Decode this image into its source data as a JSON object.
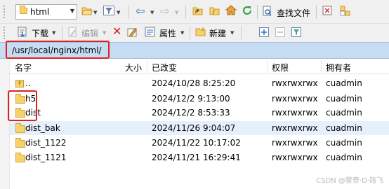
{
  "toolbar_top": {
    "drive_combo_value": "html",
    "find_files_label": "查找文件",
    "icons": [
      "folder-icon",
      "open-folder-icon",
      "filter-icon",
      "back-arrow-icon",
      "forward-arrow-icon",
      "parent-folder-icon",
      "root-folder-icon",
      "home-icon",
      "refresh-icon",
      "find-files-icon",
      "new-window-icon",
      "layout-icon"
    ]
  },
  "toolbar_bottom": {
    "download_label": "下载",
    "edit_label": "编辑",
    "properties_label": "属性",
    "new_label": "新建",
    "icons": [
      "download-icon",
      "edit-icon",
      "delete-icon",
      "rename-icon",
      "properties-icon",
      "new-folder-icon",
      "add-icon",
      "remove-icon",
      "filter-icon"
    ]
  },
  "address": {
    "path": "/usr/local/nginx/html/"
  },
  "columns": {
    "name": "名字",
    "size": "大小",
    "modified": "已改变",
    "permissions": "权限",
    "owner": "拥有者"
  },
  "files": [
    {
      "name": "..",
      "size": "",
      "modified": "2024/10/28 8:25:20",
      "permissions": "rwxrwxrwx",
      "owner": "cuadmin",
      "type": "parent"
    },
    {
      "name": "h5",
      "size": "",
      "modified": "2024/12/2 9:13:00",
      "permissions": "rwxrwxrwx",
      "owner": "cuadmin",
      "type": "folder"
    },
    {
      "name": "dist",
      "size": "",
      "modified": "2024/12/2 8:53:33",
      "permissions": "rwxrwxrwx",
      "owner": "cuadmin",
      "type": "folder"
    },
    {
      "name": "dist_bak",
      "size": "",
      "modified": "2024/11/26 9:04:07",
      "permissions": "rwxrwxrwx",
      "owner": "cuadmin",
      "type": "folder"
    },
    {
      "name": "dist_1122",
      "size": "",
      "modified": "2024/11/22 10:17:02",
      "permissions": "rwxrwxrwx",
      "owner": "cuadmin",
      "type": "folder"
    },
    {
      "name": "dist_1121",
      "size": "",
      "modified": "2024/11/21 16:29:41",
      "permissions": "rwxrwxrwx",
      "owner": "cuadmin",
      "type": "folder"
    }
  ],
  "watermark": "CSDN @蒙奇·D·路飞",
  "colors": {
    "highlight_red": "#e02020",
    "address_bar": "#c7dcf2",
    "folder": "#f7d26b",
    "selected_row": "#e6f0fb"
  }
}
